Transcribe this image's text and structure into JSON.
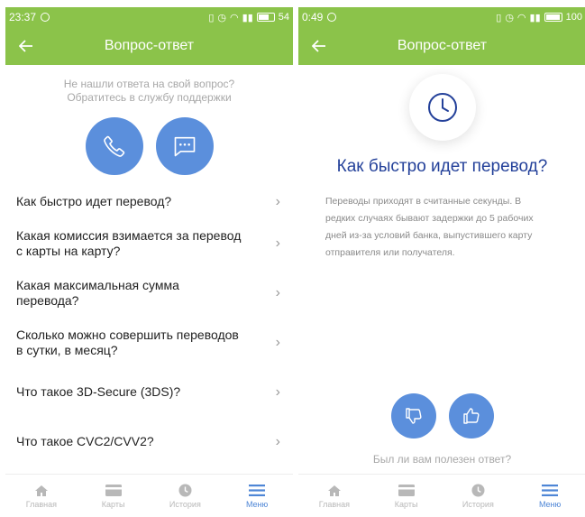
{
  "left": {
    "status": {
      "time": "23:37",
      "battery": "54"
    },
    "title": "Вопрос-ответ",
    "support_note": [
      "Не нашли ответа на свой вопрос?",
      "Обратитесь в службу поддержки"
    ],
    "faq": [
      {
        "lines": [
          "Как быстро идет перевод?"
        ]
      },
      {
        "lines": [
          "Какая комиссия взимается за перевод",
          "с карты на карту?"
        ]
      },
      {
        "lines": [
          "Какая максимальная сумма",
          "перевода?"
        ]
      },
      {
        "lines": [
          "Сколько можно совершить переводов",
          "в сутки, в месяц?"
        ]
      },
      {
        "lines": [
          "Что такое 3D-Secure (3DS)?"
        ]
      },
      {
        "lines": [
          "Что такое CVC2/CVV2?"
        ]
      }
    ]
  },
  "right": {
    "status": {
      "time": "0:49",
      "battery": "100"
    },
    "title": "Вопрос-ответ",
    "question": "Как быстро идет перевод?",
    "answer_lines": [
      "Переводы приходят в считанные секунды. В",
      "редких случаях бывают задержки до 5 рабочих",
      "дней из-за условий банка, выпустившего карту",
      "отправителя или получателя."
    ],
    "vote_question": "Был ли вам полезен ответ?"
  },
  "nav": [
    {
      "label": "Главная",
      "icon": "home-icon",
      "active": false
    },
    {
      "label": "Карты",
      "icon": "card-icon",
      "active": false
    },
    {
      "label": "История",
      "icon": "clock-icon",
      "active": false
    },
    {
      "label": "Меню",
      "icon": "menu-icon",
      "active": true
    }
  ],
  "colors": {
    "accent_green": "#8bc34a",
    "button_blue": "#5b8fdc",
    "title_blue": "#24419a",
    "nav_active": "#4e86d6"
  }
}
